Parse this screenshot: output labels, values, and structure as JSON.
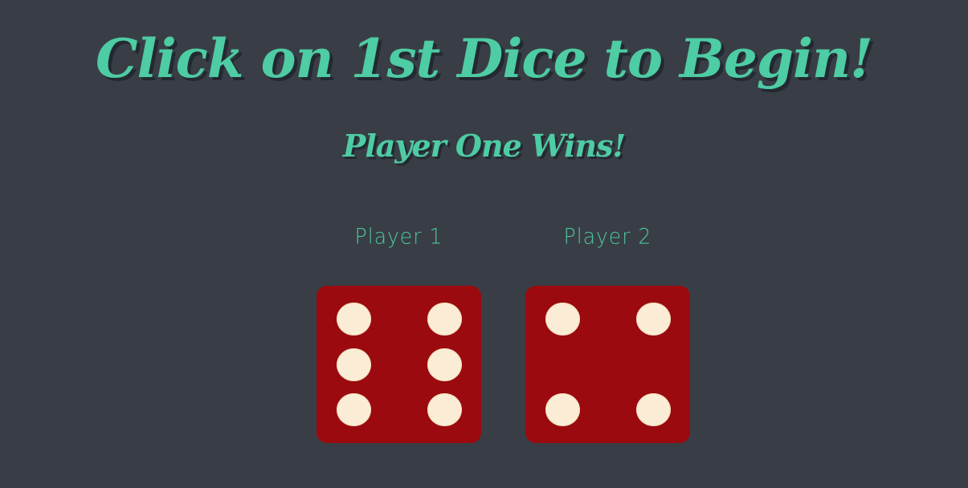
{
  "header": {
    "title": "Click on 1st Dice to Begin!",
    "result": "Player One Wins!"
  },
  "players": [
    {
      "label": "Player 1",
      "die_value": 6
    },
    {
      "label": "Player 2",
      "die_value": 4
    }
  ],
  "colors": {
    "background": "#393e46",
    "accent": "#4ecca3",
    "die_face": "#9b0a0e",
    "pip": "#fbedd5",
    "shadow": "#232931"
  }
}
